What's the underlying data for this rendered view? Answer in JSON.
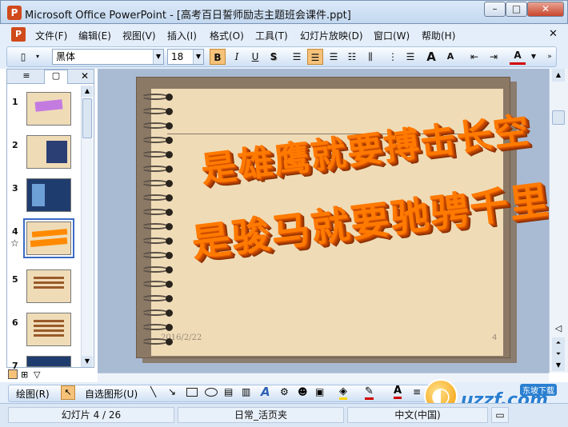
{
  "window": {
    "title": "Microsoft Office PowerPoint - [高考百日誓师励志主题班会课件.ppt]",
    "app_icon": "P",
    "min": "–",
    "max": "□",
    "close": "✕"
  },
  "menu": {
    "items": [
      "文件(F)",
      "编辑(E)",
      "视图(V)",
      "插入(I)",
      "格式(O)",
      "工具(T)",
      "幻灯片放映(D)",
      "窗口(W)",
      "帮助(H)"
    ],
    "close_doc": "✕"
  },
  "toolbar": {
    "font": "黑体",
    "size": "18",
    "bold": "B",
    "italic": "I",
    "underline": "U",
    "shadow": "S",
    "grow": "A",
    "shrink": "A",
    "font_color": "A"
  },
  "pane": {
    "tab_outline": "≡",
    "tab_slides": "▢",
    "close": "✕",
    "thumbnails": [
      {
        "num": "1"
      },
      {
        "num": "2"
      },
      {
        "num": "3"
      },
      {
        "num": "4"
      },
      {
        "num": "5"
      },
      {
        "num": "6"
      },
      {
        "num": "7"
      }
    ]
  },
  "slide": {
    "line1": "是雄鹰就要搏击长空",
    "line2": "是骏马就要驰骋千里",
    "date": "2016/2/22",
    "page_number": "4"
  },
  "drawbar": {
    "draw": "绘图(R)",
    "autoshapes": "自选图形(U)"
  },
  "status": {
    "slide_info": "幻灯片 4 / 26",
    "design": "日常_活页夹",
    "language": "中文(中国)"
  },
  "watermark": {
    "text": "uzzf.com",
    "tag": "东坡下载"
  },
  "colors": {
    "accent": "#ff7a00",
    "slide_bg": "#efdcb7",
    "slide_frame": "#8b7966"
  }
}
